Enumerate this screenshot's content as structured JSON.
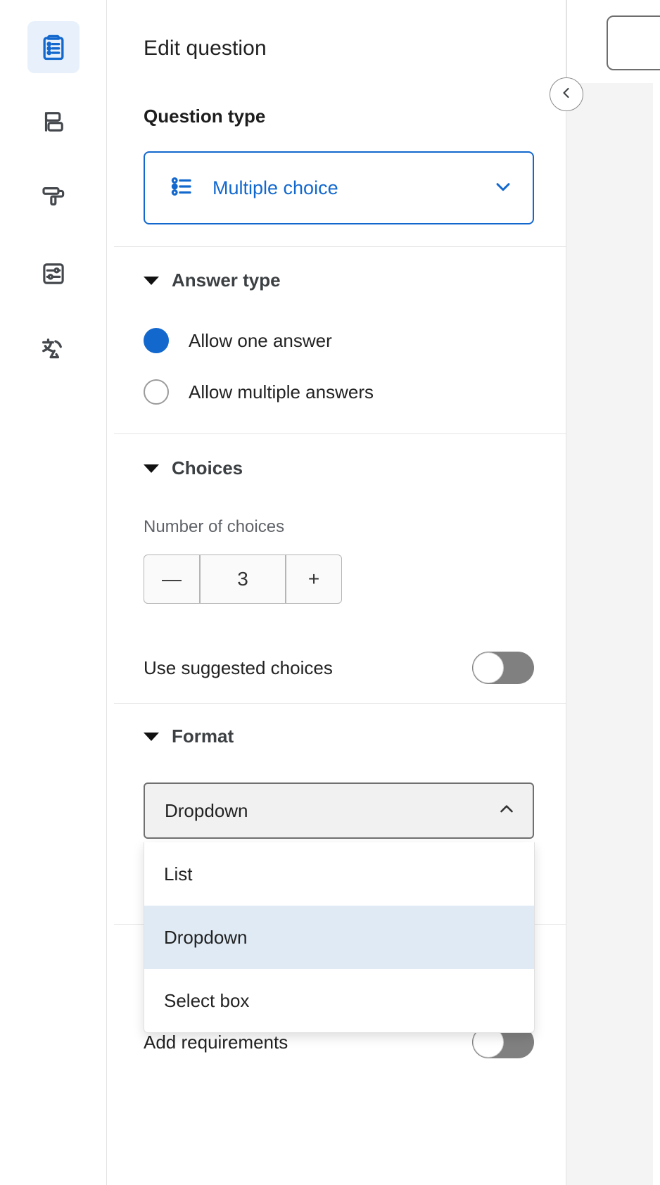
{
  "sidebar": {
    "items": [
      {
        "icon": "clipboard-list-icon",
        "name": "questions",
        "active": true
      },
      {
        "icon": "layout-blocks-icon",
        "name": "layout",
        "active": false
      },
      {
        "icon": "paint-roller-icon",
        "name": "theme",
        "active": false
      },
      {
        "icon": "sliders-box-icon",
        "name": "settings",
        "active": false
      },
      {
        "icon": "translate-icon",
        "name": "language",
        "active": false
      }
    ]
  },
  "panel": {
    "title": "Edit question",
    "question_type": {
      "label": "Question type",
      "selected": "Multiple choice",
      "icon": "bullet-list-icon",
      "chevron": "chevron-down-icon",
      "accent_color": "#1368ce"
    },
    "answer_type": {
      "heading": "Answer type",
      "options": [
        {
          "label": "Allow one answer",
          "checked": true
        },
        {
          "label": "Allow multiple answers",
          "checked": false
        }
      ]
    },
    "choices": {
      "heading": "Choices",
      "number_caption": "Number of choices",
      "stepper": {
        "decrement": "—",
        "value": "3",
        "increment": "+"
      },
      "suggested": {
        "label": "Use suggested choices",
        "state": "off"
      }
    },
    "format": {
      "heading": "Format",
      "selected": "Dropdown",
      "chevron": "chevron-up-icon",
      "options": [
        {
          "label": "List",
          "selected": false
        },
        {
          "label": "Dropdown",
          "selected": true
        },
        {
          "label": "Select box",
          "selected": false
        }
      ],
      "highlight_color": "#dfeaf5"
    },
    "requirements": {
      "label": "Add requirements",
      "state": "off"
    }
  },
  "collapse_button": {
    "icon": "chevron-left-icon"
  }
}
